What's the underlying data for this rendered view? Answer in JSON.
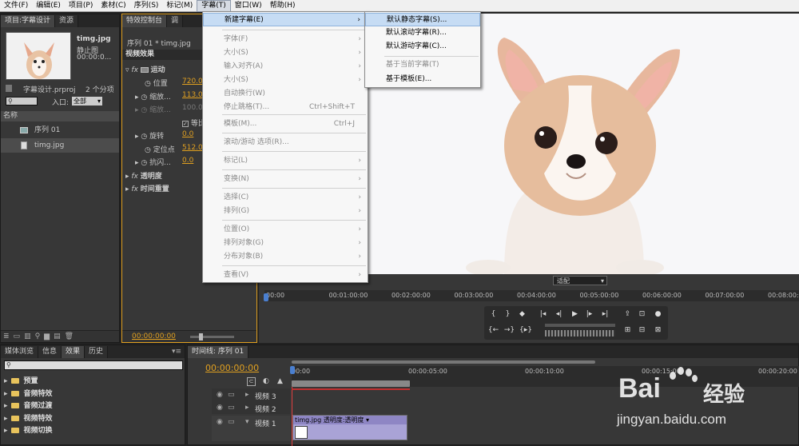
{
  "menubar": [
    "文件(F)",
    "编辑(E)",
    "项目(P)",
    "素材(C)",
    "序列(S)",
    "标记(M)",
    "字幕(T)",
    "窗口(W)",
    "帮助(H)"
  ],
  "project_panel": {
    "tabs": [
      "项目:字幕设计",
      "资源"
    ],
    "clip_name": "timg.jpg",
    "clip_type": "静止图",
    "clip_time": "00:00:0...",
    "project_file": "字幕设计.prproj",
    "item_count": "2 个分项",
    "entry_label": "入口:",
    "entry_value": "全部",
    "name_header": "名称",
    "items": [
      "序列 01",
      "timg.jpg"
    ]
  },
  "effect_controls": {
    "tabs": [
      "特效控制台",
      "调"
    ],
    "header": "序列 01 * timg.jpg",
    "section": "视频效果",
    "motion": "运动",
    "position_label": "位置",
    "position_value": "720.0",
    "scale_label": "缩放...",
    "scale_value": "113.0",
    "scale_width_label": "缩放...",
    "scale_width_value": "100.0",
    "uniform_label": "等比",
    "rotation_label": "旋转",
    "rotation_value": "0.0",
    "anchor_label": "定位点",
    "anchor_value": "512.0",
    "flicker_label": "抗闪...",
    "flicker_value": "0.0",
    "opacity": "透明度",
    "time_remap": "时间重置",
    "timecode": "00:00:00:00"
  },
  "title_menu": {
    "items": [
      {
        "label": "新建字幕(E)",
        "arrow": true,
        "hl": true
      },
      {
        "label": "字体(F)",
        "arrow": true,
        "dis": true
      },
      {
        "label": "大小(S)",
        "arrow": true,
        "dis": true
      },
      {
        "label": "输入对齐(A)",
        "arrow": true,
        "dis": true
      },
      {
        "label": "大小(S)",
        "arrow": true,
        "dis": true
      },
      {
        "label": "自动换行(W)",
        "dis": true
      },
      {
        "label": "停止跳格(T)...",
        "shortcut": "Ctrl+Shift+T",
        "dis": true
      },
      {
        "label": "模板(M)...",
        "shortcut": "Ctrl+J",
        "dis": true
      },
      {
        "label": "滚动/游动 选项(R)...",
        "dis": true
      },
      {
        "label": "标记(L)",
        "arrow": true,
        "dis": true
      },
      {
        "label": "变换(N)",
        "arrow": true,
        "dis": true
      },
      {
        "label": "选择(C)",
        "arrow": true,
        "dis": true
      },
      {
        "label": "排列(G)",
        "arrow": true,
        "dis": true
      },
      {
        "label": "位置(O)",
        "arrow": true,
        "dis": true
      },
      {
        "label": "排列对象(G)",
        "arrow": true,
        "dis": true
      },
      {
        "label": "分布对象(B)",
        "arrow": true,
        "dis": true
      },
      {
        "label": "查看(V)",
        "arrow": true,
        "dis": true
      }
    ]
  },
  "submenu": [
    "默认静态字幕(S)...",
    "默认滚动字幕(R)...",
    "默认游动字幕(C)...",
    "基于当前字幕(T)",
    "基于模板(E)..."
  ],
  "program_monitor": {
    "fit": "适配",
    "ruler": [
      "00:00",
      "00:01:00:00",
      "00:02:00:00",
      "00:03:00:00",
      "00:04:00:00",
      "00:05:00:00",
      "00:06:00:00",
      "00:07:00:00",
      "00:08:00:00"
    ]
  },
  "effects_panel": {
    "tabs": [
      "媒体浏览",
      "信息",
      "效果",
      "历史"
    ],
    "folders": [
      "预置",
      "音频特效",
      "音频过渡",
      "视频特效",
      "视频切换"
    ]
  },
  "timeline": {
    "tab": "时间线: 序列 01",
    "timecode": "00:00:00:00",
    "ruler": [
      "00:00",
      "00:00:05:00",
      "00:00:10:00",
      "00:00:15:00",
      "00:00:20:00"
    ],
    "tracks": [
      "视频 3",
      "视频 2",
      "视频 1"
    ],
    "clip_label": "timg.jpg 透明度:透明度"
  },
  "watermark": {
    "brand": "Bai",
    "brand2": "经验",
    "url": "jingyan.baidu.com"
  }
}
